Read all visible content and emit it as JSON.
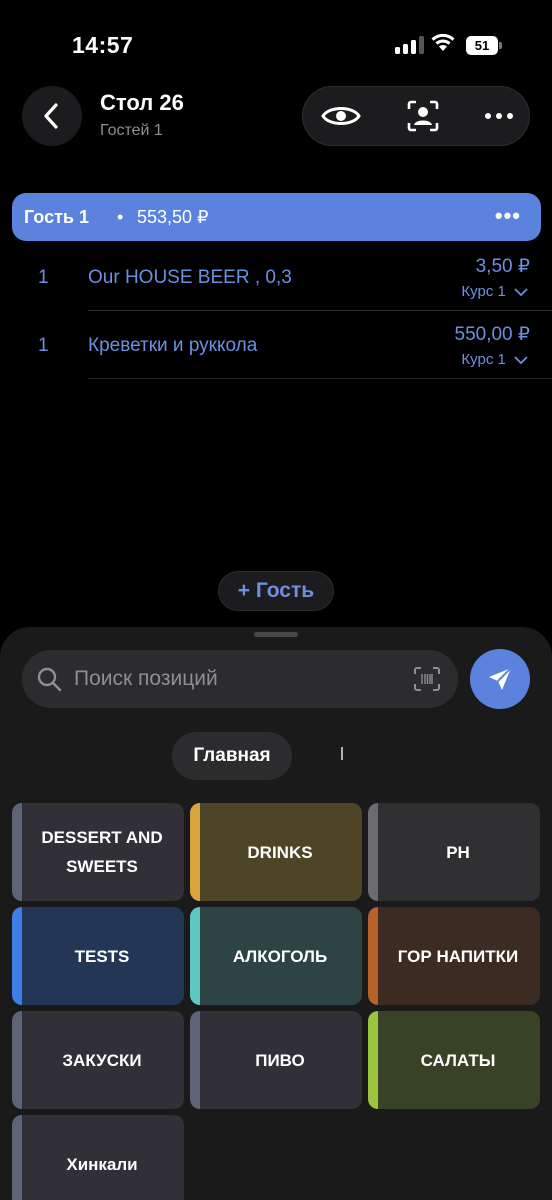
{
  "status_bar": {
    "time": "14:57",
    "battery": "51"
  },
  "header": {
    "title": "Стол 26",
    "subtitle": "Гостей 1"
  },
  "guest": {
    "name": "Гость 1",
    "separator": "•",
    "total": "553,50 ₽",
    "more": "•••"
  },
  "items": [
    {
      "qty": "1",
      "name": "Our HOUSE BEER , 0,3",
      "price": "3,50 ₽",
      "course": "Курс 1"
    },
    {
      "qty": "1",
      "name": "Креветки и руккола",
      "price": "550,00 ₽",
      "course": "Курс 1"
    }
  ],
  "add_guest_label": "+ Гость",
  "search": {
    "placeholder": "Поиск позиций"
  },
  "tabs": [
    {
      "label": "Главная"
    },
    {
      "label": "I"
    }
  ],
  "categories": [
    {
      "label": "DESSERT AND SWEETS",
      "bg": "#303036",
      "stripe": "#5c6476"
    },
    {
      "label": "DRINKS",
      "bg": "#4e4426",
      "stripe": "#d9a43e"
    },
    {
      "label": "PH",
      "bg": "#303033",
      "stripe": "#6b6b70"
    },
    {
      "label": "TESTS",
      "bg": "#233656",
      "stripe": "#3d7fe6"
    },
    {
      "label": "АЛКОГОЛЬ",
      "bg": "#2d4442",
      "stripe": "#5fc7c1"
    },
    {
      "label": "ГОР НАПИТКИ",
      "bg": "#3c2b22",
      "stripe": "#b7622a"
    },
    {
      "label": "ЗАКУСКИ",
      "bg": "#303036",
      "stripe": "#5c6476"
    },
    {
      "label": "ПИВО",
      "bg": "#303036",
      "stripe": "#5c6476"
    },
    {
      "label": "САЛАТЫ",
      "bg": "#384226",
      "stripe": "#9ac43c"
    },
    {
      "label": "Хинкали",
      "bg": "#303036",
      "stripe": "#5c6476"
    }
  ],
  "colors": {
    "accent": "#5b82dc",
    "item_text": "#6e8fe0"
  }
}
